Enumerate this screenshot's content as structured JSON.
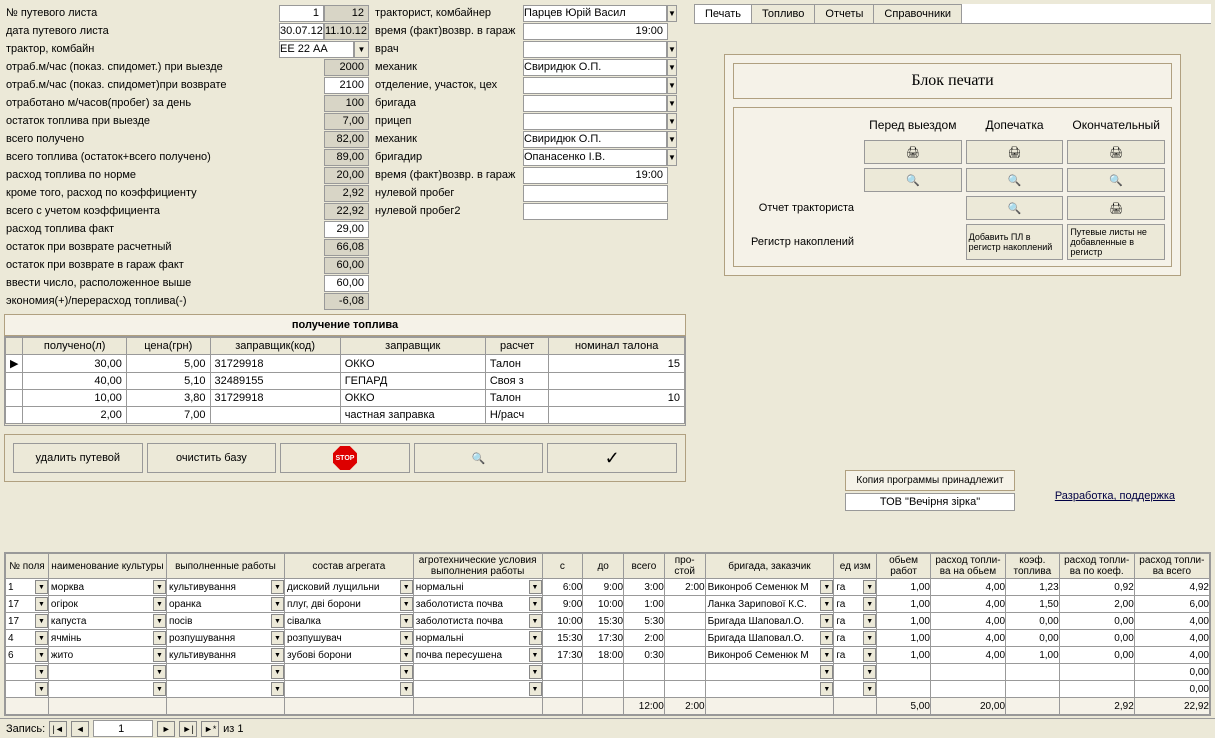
{
  "left": {
    "rows": [
      {
        "label": "№ путевого листа",
        "v1": "1",
        "v2": "12"
      },
      {
        "label": "дата путевого листа",
        "v1": "30.07.12",
        "v2": "11.10.12"
      },
      {
        "label": "трактор, комбайн",
        "combo": "ЕЕ 22 АА"
      },
      {
        "label": "отраб.м/час (показ. спидомет.) при выезде",
        "v2": "2000"
      },
      {
        "label": "отраб.м/час (показ. спидомет)при возврате",
        "v1": "2100"
      },
      {
        "label": "отработано м/часов(пробег) за день",
        "v2": "100"
      },
      {
        "label": "остаток топлива при выезде",
        "v2": "7,00"
      },
      {
        "label": "всего получено",
        "v2": "82,00"
      },
      {
        "label": "всего топлива (остаток+всего получено)",
        "v2": "89,00"
      },
      {
        "label": "расход топлива по норме",
        "v2": "20,00"
      },
      {
        "label": "кроме того, расход по коэффициенту",
        "v2": "2,92"
      },
      {
        "label": "всего с учетом коэффициента",
        "v2": "22,92"
      },
      {
        "label": "расход топлива факт",
        "v1": "29,00"
      },
      {
        "label": "остаток при возврате расчетный",
        "v2": "66,08"
      },
      {
        "label": "остаток при возврате в гараж  факт",
        "v2": "60,00"
      },
      {
        "label": "ввести число, расположенное выше",
        "v1": "60,00"
      },
      {
        "label": "экономия(+)/перерасход топлива(-)",
        "v2": "-6,08"
      }
    ]
  },
  "right": {
    "rows": [
      {
        "label": "тракторист, комбайнер",
        "combo": "Парцев Юрій Васил"
      },
      {
        "label": "время (факт)возвр. в гараж",
        "val": "19:00"
      },
      {
        "label": "врач",
        "combo": ""
      },
      {
        "label": "механик",
        "combo": "Свиридюк О.П."
      },
      {
        "label": "отделение, участок, цех",
        "combo": ""
      },
      {
        "label": "бригада",
        "combo": ""
      },
      {
        "label": "прицеп",
        "combo": ""
      },
      {
        "label": "механик",
        "combo": "Свиридюк О.П."
      },
      {
        "label": "бригадир",
        "combo": "Опанасенко І.В."
      },
      {
        "label": "время (факт)возвр. в гараж",
        "val": "19:00"
      },
      {
        "label": "нулевой пробег",
        "val": ""
      },
      {
        "label": "нулевой пробег2",
        "val": ""
      }
    ]
  },
  "fuel_header": "получение топлива",
  "fuel_cols": [
    "получено(л)",
    "цена(грн)",
    "заправщик(код)",
    "заправщик",
    "расчет",
    "номинал талона"
  ],
  "fuel_rows": [
    {
      "v": [
        "30,00",
        "5,00",
        "31729918",
        "ОККО",
        "Талон",
        "15"
      ]
    },
    {
      "v": [
        "40,00",
        "5,10",
        "32489155",
        "ГЕПАРД",
        "Своя з",
        ""
      ]
    },
    {
      "v": [
        "10,00",
        "3,80",
        "31729918",
        "ОККО",
        "Талон",
        "10"
      ]
    },
    {
      "v": [
        "2,00",
        "7,00",
        "",
        "частная заправка",
        "Н/расч",
        ""
      ]
    }
  ],
  "buttons": {
    "del": "удалить путевой",
    "clear": "очистить базу"
  },
  "tabs": [
    "Печать",
    "Топливо",
    "Отчеты",
    "Справочники"
  ],
  "print": {
    "title": "Блок печати",
    "cols": [
      "Перед выездом",
      "Допечатка",
      "Окончательный"
    ],
    "row_report": "Отчет тракториста",
    "row_reg": "Регистр накоплений",
    "btn_add": "Добавить ПЛ в регистр накоплений",
    "btn_missing": "Путевые листы не добавленные в регистр"
  },
  "owner": {
    "lbl": "Копия программы принадлежит",
    "name": "ТОВ \"Вечірня зірка\""
  },
  "link": "Разработка, поддержка",
  "grid": {
    "cols": [
      "№ поля",
      "наименование культуры",
      "выполненные работы",
      "состав агрегата",
      "агротехнические условия выполнения работы",
      "с",
      "до",
      "всего",
      "про- стой",
      "бригада, заказчик",
      "ед изм",
      "обьем работ",
      "расход топли- ва на обьем",
      "коэф. топлива",
      "расход топли- ва по коеф.",
      "расход топли- ва всего"
    ],
    "rows": [
      {
        "c": [
          "1",
          "морква",
          "культивування",
          "дисковий лущильни",
          "нормальні",
          "6:00",
          "9:00",
          "3:00",
          "2:00",
          "Виконроб Семенюк М",
          "га",
          "1,00",
          "4,00",
          "1,23",
          "0,92",
          "4,92"
        ]
      },
      {
        "c": [
          "17",
          "огірок",
          "оранка",
          "плуг, дві борони",
          "заболотиста почва",
          "9:00",
          "10:00",
          "1:00",
          "",
          "Ланка Зарипової К.С.",
          "га",
          "1,00",
          "4,00",
          "1,50",
          "2,00",
          "6,00"
        ]
      },
      {
        "c": [
          "17",
          "капуста",
          "посів",
          "сівалка",
          "заболотиста почва",
          "10:00",
          "15:30",
          "5:30",
          "",
          "Бригада Шаповал.О.",
          "га",
          "1,00",
          "4,00",
          "0,00",
          "0,00",
          "4,00"
        ]
      },
      {
        "c": [
          "4",
          "ячмінь",
          "розпушування",
          "розпушувач",
          "нормальні",
          "15:30",
          "17:30",
          "2:00",
          "",
          "Бригада Шаповал.О.",
          "га",
          "1,00",
          "4,00",
          "0,00",
          "0,00",
          "4,00"
        ]
      },
      {
        "c": [
          "6",
          "жито",
          "культивування",
          "зубові борони",
          "почва пересушена",
          "17:30",
          "18:00",
          "0:30",
          "",
          "Виконроб Семенюк М",
          "га",
          "1,00",
          "4,00",
          "1,00",
          "0,00",
          "4,00"
        ]
      },
      {
        "c": [
          "",
          "",
          "",
          "",
          "",
          "",
          "",
          "",
          "",
          "",
          "",
          "",
          "",
          "",
          "",
          "0,00"
        ]
      },
      {
        "c": [
          "",
          "",
          "",
          "",
          "",
          "",
          "",
          "",
          "",
          "",
          "",
          "",
          "",
          "",
          "",
          "0,00"
        ]
      }
    ],
    "totals": [
      "",
      "",
      "",
      "",
      "",
      "",
      "",
      "12:00",
      "2:00",
      "",
      "",
      "5,00",
      "20,00",
      "",
      "2,92",
      "22,92"
    ]
  },
  "status": {
    "label": "Запись:",
    "pos": "1",
    "of": "из 1"
  }
}
